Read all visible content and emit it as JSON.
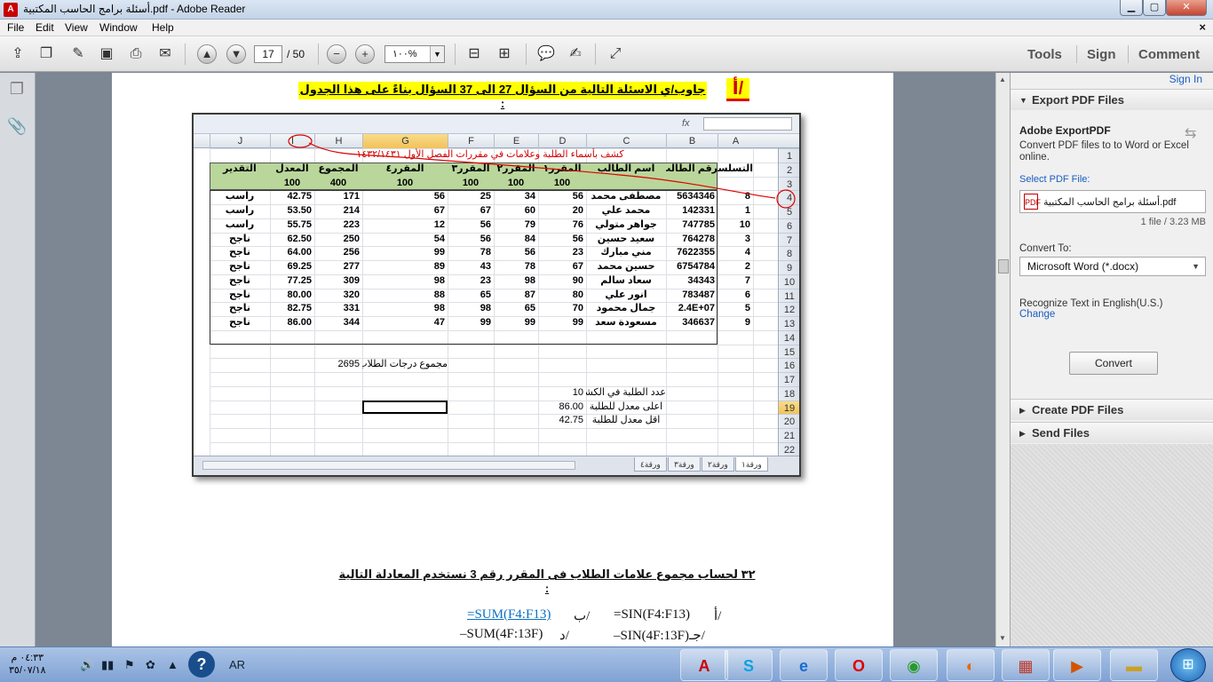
{
  "window": {
    "title": "أسئلة برامج الحاسب المكتبية.pdf - Adobe Reader"
  },
  "menu": [
    "File",
    "Edit",
    "View",
    "Window",
    "Help"
  ],
  "toolbar": {
    "page_current": "17",
    "page_total": "/ 50",
    "zoom": "١٠٠%",
    "tools": "Tools",
    "sign": "Sign",
    "comment": "Comment"
  },
  "document": {
    "question_header": "جاوب/ي الاسئلة التالية من السؤال 27 الى 37 السؤال بناءً على هذا الجدول :",
    "question_mark": "أ/",
    "excel": {
      "col_headers": [
        "J",
        "I",
        "H",
        "G",
        "F",
        "E",
        "D",
        "C",
        "B",
        "A"
      ],
      "row_numbers": [
        "1",
        "2",
        "3",
        "4",
        "5",
        "6",
        "7",
        "8",
        "9",
        "10",
        "11",
        "12",
        "13",
        "14",
        "15",
        "16",
        "17",
        "18",
        "19",
        "20",
        "21",
        "22"
      ],
      "title_row": "كشف بأسماء الطلبة وعلامات في مقررات الفصل الأول ١٤٣٢/١٤٣١",
      "header_row": [
        "التقدير",
        "المعدل",
        "المجموع",
        "المقرر٤",
        "المقرر٣",
        "المقرر٢",
        "المقرر١",
        "اسم الطالب",
        "رقم الطالب",
        "التسلسل"
      ],
      "max_row": [
        "",
        "100",
        "400",
        "100",
        "100",
        "100",
        "100",
        "",
        "",
        ""
      ],
      "rows": [
        [
          "راسب",
          "42.75",
          "171",
          "56",
          "25",
          "34",
          "56",
          "مصطفى محمد",
          "5634346",
          "8"
        ],
        [
          "راسب",
          "53.50",
          "214",
          "67",
          "67",
          "60",
          "20",
          "محمد علي",
          "142331",
          "1"
        ],
        [
          "راسب",
          "55.75",
          "223",
          "12",
          "56",
          "79",
          "76",
          "جواهر متولي",
          "747785",
          "10"
        ],
        [
          "ناجح",
          "62.50",
          "250",
          "54",
          "56",
          "84",
          "56",
          "سعيد حسين",
          "764278",
          "3"
        ],
        [
          "ناجح",
          "64.00",
          "256",
          "99",
          "78",
          "56",
          "23",
          "مني مبارك",
          "7622355",
          "4"
        ],
        [
          "ناجح",
          "69.25",
          "277",
          "89",
          "43",
          "78",
          "67",
          "حسين محمد",
          "6754784",
          "2"
        ],
        [
          "ناجح",
          "77.25",
          "309",
          "98",
          "23",
          "98",
          "90",
          "سعاد سالم",
          "34343",
          "7"
        ],
        [
          "ناجح",
          "80.00",
          "320",
          "88",
          "65",
          "87",
          "80",
          "انور علي",
          "783487",
          "6"
        ],
        [
          "ناجح",
          "82.75",
          "331",
          "98",
          "98",
          "65",
          "70",
          "جمال محمود",
          "2.4E+07",
          "5"
        ],
        [
          "ناجح",
          "86.00",
          "344",
          "47",
          "99",
          "99",
          "99",
          "مسعودة سعد",
          "346637",
          "9"
        ]
      ],
      "sum_label": "مجموع درجات الطلاب",
      "sum_value": "2695",
      "count_label": "عدد الطلبة في الكشف",
      "count_value": "10",
      "max_label": "اعلى معدل للطلبة",
      "max_value": "86.00",
      "min_label": "اقل معدل للطلبة",
      "min_value": "42.75",
      "tabs": [
        "ورقة١",
        "ورقة٢",
        "ورقة٣",
        "ورقة٤"
      ]
    },
    "q32": {
      "text": "٣٢ لحساب مجموع علامات الطلاب فى المقرر رقم 3 نستخدم المعادلة التالية :",
      "opt_a_label": "أ/",
      "opt_a": "=SIN(F4:F13)",
      "opt_b_label": "ب/",
      "opt_b": "=SUM(F4:F13)",
      "opt_c_label": "جـ/",
      "opt_c": "–SIN(4F:13F)",
      "opt_d_label": "د/",
      "opt_d": "–SUM(4F:13F)"
    }
  },
  "panel": {
    "sign_in": "Sign In",
    "export_header": "Export PDF Files",
    "export_title": "Adobe ExportPDF",
    "export_desc": "Convert PDF files to to Word or Excel online.",
    "select_label": "Select PDF File:",
    "file_name": "أسئلة برامج الحاسب المكتبية.pdf",
    "file_count": "1 file / 3.23 MB",
    "convert_to_label": "Convert To:",
    "convert_to_value": "Microsoft Word (*.docx)",
    "recognize": "Recognize Text in English(U.S.)",
    "change": "Change",
    "convert_btn": "Convert",
    "create_header": "Create PDF Files",
    "send_header": "Send Files"
  },
  "taskbar": {
    "time": "٠٤:٣٣ م",
    "date": "٣٥/٠٧/١٨",
    "lang": "AR"
  }
}
